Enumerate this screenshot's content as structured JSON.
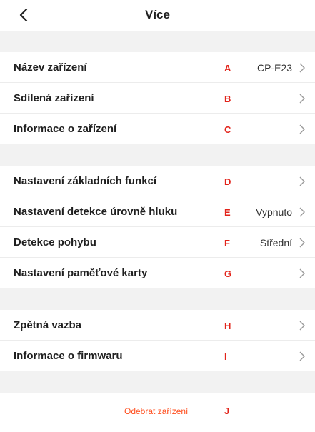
{
  "header": {
    "title": "Více",
    "back_icon": "chevron-left-icon"
  },
  "groups": [
    {
      "items": [
        {
          "label": "Název zařízení",
          "marker": "A",
          "value": "CP-E23"
        },
        {
          "label": "Sdílená zařízení",
          "marker": "B",
          "value": ""
        },
        {
          "label": "Informace o zařízení",
          "marker": "C",
          "value": ""
        }
      ]
    },
    {
      "items": [
        {
          "label": "Nastavení základních funkcí",
          "marker": "D",
          "value": ""
        },
        {
          "label": "Nastavení detekce úrovně hluku",
          "marker": "E",
          "value": "Vypnuto"
        },
        {
          "label": "Detekce pohybu",
          "marker": "F",
          "value": "Střední"
        },
        {
          "label": "Nastavení paměťové karty",
          "marker": "G",
          "value": ""
        }
      ]
    },
    {
      "items": [
        {
          "label": "Zpětná vazba",
          "marker": "H",
          "value": ""
        },
        {
          "label": "Informace o firmwaru",
          "marker": "I",
          "value": ""
        }
      ]
    }
  ],
  "remove": {
    "label": "Odebrat zařízení",
    "marker": "J"
  },
  "colors": {
    "marker": "#e2231a",
    "remove": "#ff4f1f",
    "section_gap": "#f2f2f2"
  }
}
